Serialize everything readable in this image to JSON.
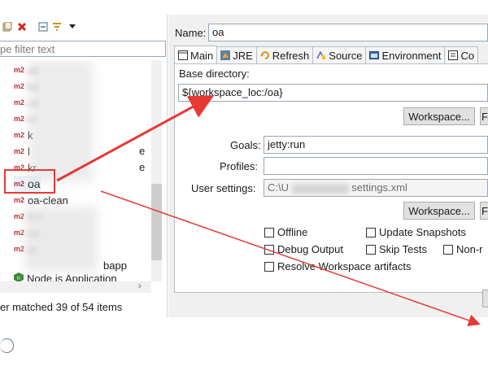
{
  "left": {
    "filter_placeholder": "pe filter text",
    "tree": [
      {
        "badge": "m2",
        "label": "ab",
        "blurred": true
      },
      {
        "badge": "m2",
        "label": "ba",
        "blurred": true
      },
      {
        "badge": "m2",
        "label": "cd",
        "blurred": true
      },
      {
        "badge": "m2",
        "label": "ef",
        "blurred": true
      },
      {
        "badge": "m2",
        "label": "k",
        "blurred": false
      },
      {
        "badge": "m2",
        "label": "l",
        "blurred": false
      },
      {
        "badge": "m2",
        "label": "kr",
        "blurred": false
      },
      {
        "badge": "m2",
        "label": "oa",
        "blurred": false
      },
      {
        "badge": "m2",
        "label": "oa-clean",
        "blurred": false
      },
      {
        "badge": "m2",
        "label": "mn",
        "blurred": true
      },
      {
        "badge": "m2",
        "label": "op",
        "blurred": true
      },
      {
        "badge": "m2",
        "label": "qr",
        "blurred": true
      },
      {
        "badge": "m2",
        "label": "bapp",
        "blurred": false
      },
      {
        "badge": "node",
        "label": "Node.js Application",
        "blurred": false
      }
    ],
    "tree_fragments": {
      "row5_suffix": "e",
      "row6_suffix": "e"
    },
    "status": "er matched 39 of 54 items"
  },
  "right": {
    "name_label": "Name:",
    "name_value": "oa",
    "tabs": [
      {
        "label": "Main",
        "icon": "main-tab-icon"
      },
      {
        "label": "JRE",
        "icon": "jre-icon"
      },
      {
        "label": "Refresh",
        "icon": "refresh-icon"
      },
      {
        "label": "Source",
        "icon": "source-icon"
      },
      {
        "label": "Environment",
        "icon": "environment-icon"
      },
      {
        "label": "Co",
        "icon": "common-icon"
      }
    ],
    "base_dir_label": "Base directory:",
    "base_dir_value": "${workspace_loc:/oa}",
    "workspace_btn": "Workspace...",
    "fs_btn": "F",
    "goals_label": "Goals:",
    "goals_value": "jetty:run",
    "profiles_label": "Profiles:",
    "profiles_value": "",
    "user_settings_label": "User settings:",
    "user_settings_value_start": "C:\\U",
    "user_settings_value_end": "settings.xml",
    "workspace_btn2": "Workspace...",
    "fs_btn2": "F",
    "checkboxes": {
      "offline": "Offline",
      "update_snapshots": "Update Snapshots",
      "debug_output": "Debug Output",
      "skip_tests": "Skip Tests",
      "non_recursive": "Non-r",
      "resolve_workspace": "Resolve Workspace artifacts"
    }
  },
  "colors": {
    "annotation_red": "#e53935",
    "maven_badge": "#c0282d",
    "node_green": "#3c873a"
  }
}
